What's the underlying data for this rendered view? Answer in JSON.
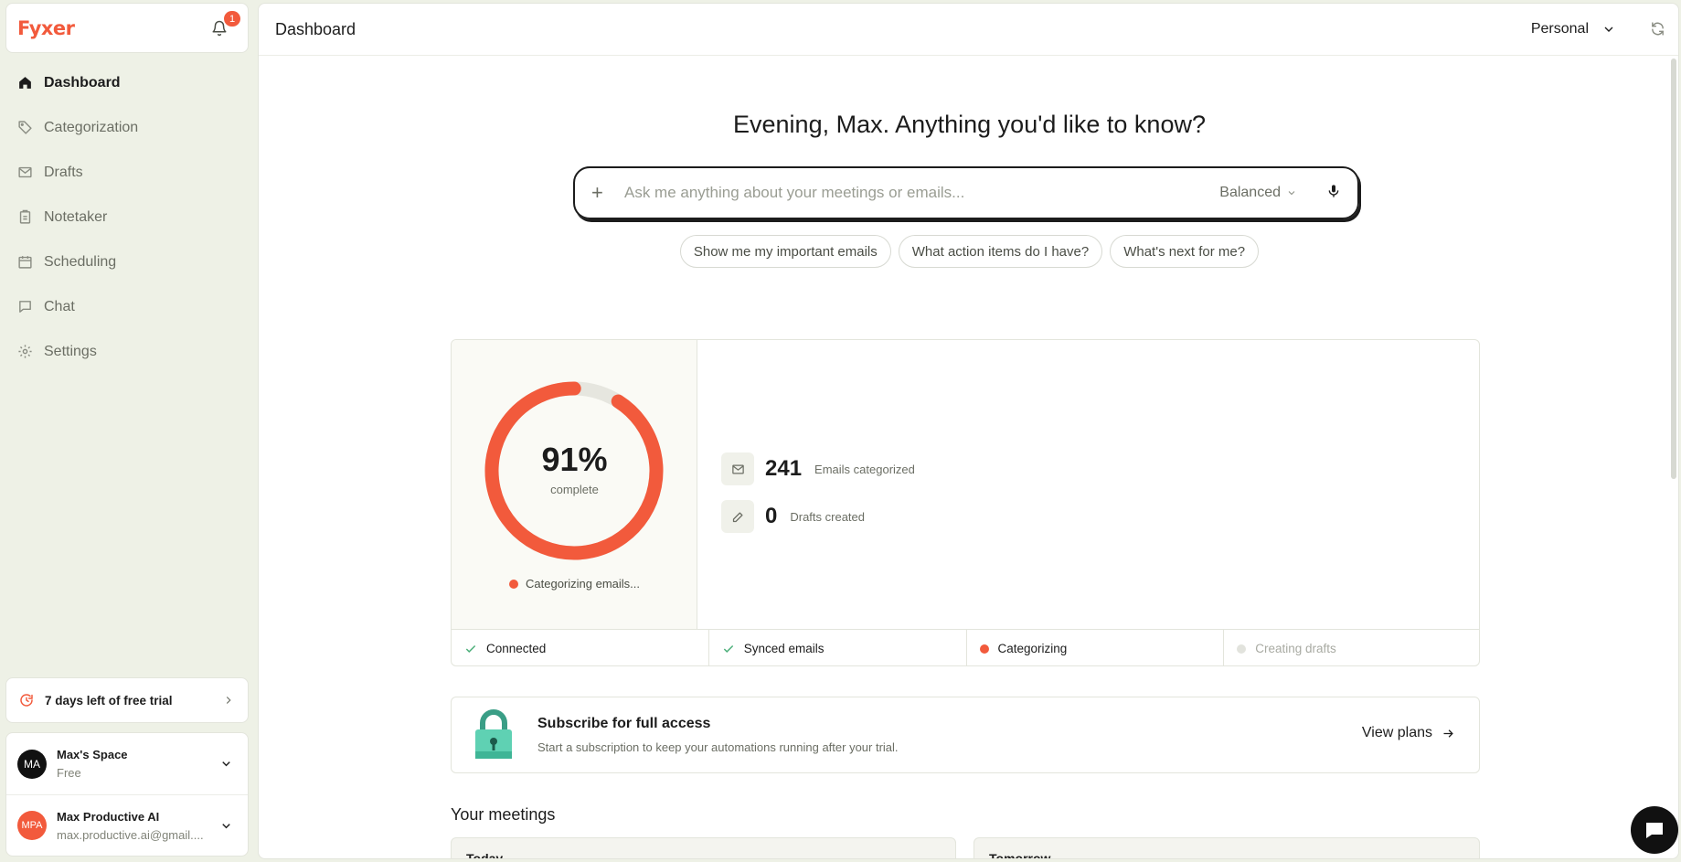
{
  "brand": {
    "logo_text": "Fyxer",
    "notifications_count": "1",
    "accent": "#f25a3c"
  },
  "sidebar": {
    "items": [
      {
        "label": "Dashboard",
        "icon": "home-icon",
        "active": true
      },
      {
        "label": "Categorization",
        "icon": "tag-icon"
      },
      {
        "label": "Drafts",
        "icon": "mail-icon"
      },
      {
        "label": "Notetaker",
        "icon": "clipboard-icon"
      },
      {
        "label": "Scheduling",
        "icon": "calendar-icon"
      },
      {
        "label": "Chat",
        "icon": "chat-bubble-icon"
      },
      {
        "label": "Settings",
        "icon": "gear-icon"
      }
    ],
    "trial_label": "7 days left of free trial",
    "workspace": {
      "initials": "MA",
      "name": "Max's Space",
      "plan": "Free"
    },
    "account": {
      "initials": "MPA",
      "name": "Max Productive AI",
      "email": "max.productive.ai@gmail...."
    }
  },
  "header": {
    "title": "Dashboard",
    "workspace_selector": "Personal"
  },
  "assistant": {
    "greeting": "Evening, Max. Anything you'd like to know?",
    "placeholder": "Ask me anything about your meetings or emails...",
    "mode": "Balanced",
    "suggestions": [
      "Show me my important emails",
      "What action items do I have?",
      "What's next for me?"
    ]
  },
  "progress": {
    "percent_label": "91%",
    "percent_value": 91,
    "complete_label": "complete",
    "status": "Categorizing emails...",
    "stats": [
      {
        "value": "241",
        "label": "Emails categorized",
        "icon": "mail-icon"
      },
      {
        "value": "0",
        "label": "Drafts created",
        "icon": "pencil-icon"
      }
    ],
    "steps": [
      {
        "label": "Connected",
        "state": "done"
      },
      {
        "label": "Synced emails",
        "state": "done"
      },
      {
        "label": "Categorizing",
        "state": "active"
      },
      {
        "label": "Creating drafts",
        "state": "pending"
      }
    ]
  },
  "subscribe": {
    "title": "Subscribe for full access",
    "description": "Start a subscription to keep your automations running after your trial.",
    "cta": "View plans"
  },
  "meetings": {
    "title": "Your meetings",
    "today": "Today",
    "tomorrow": "Tomorrow"
  }
}
